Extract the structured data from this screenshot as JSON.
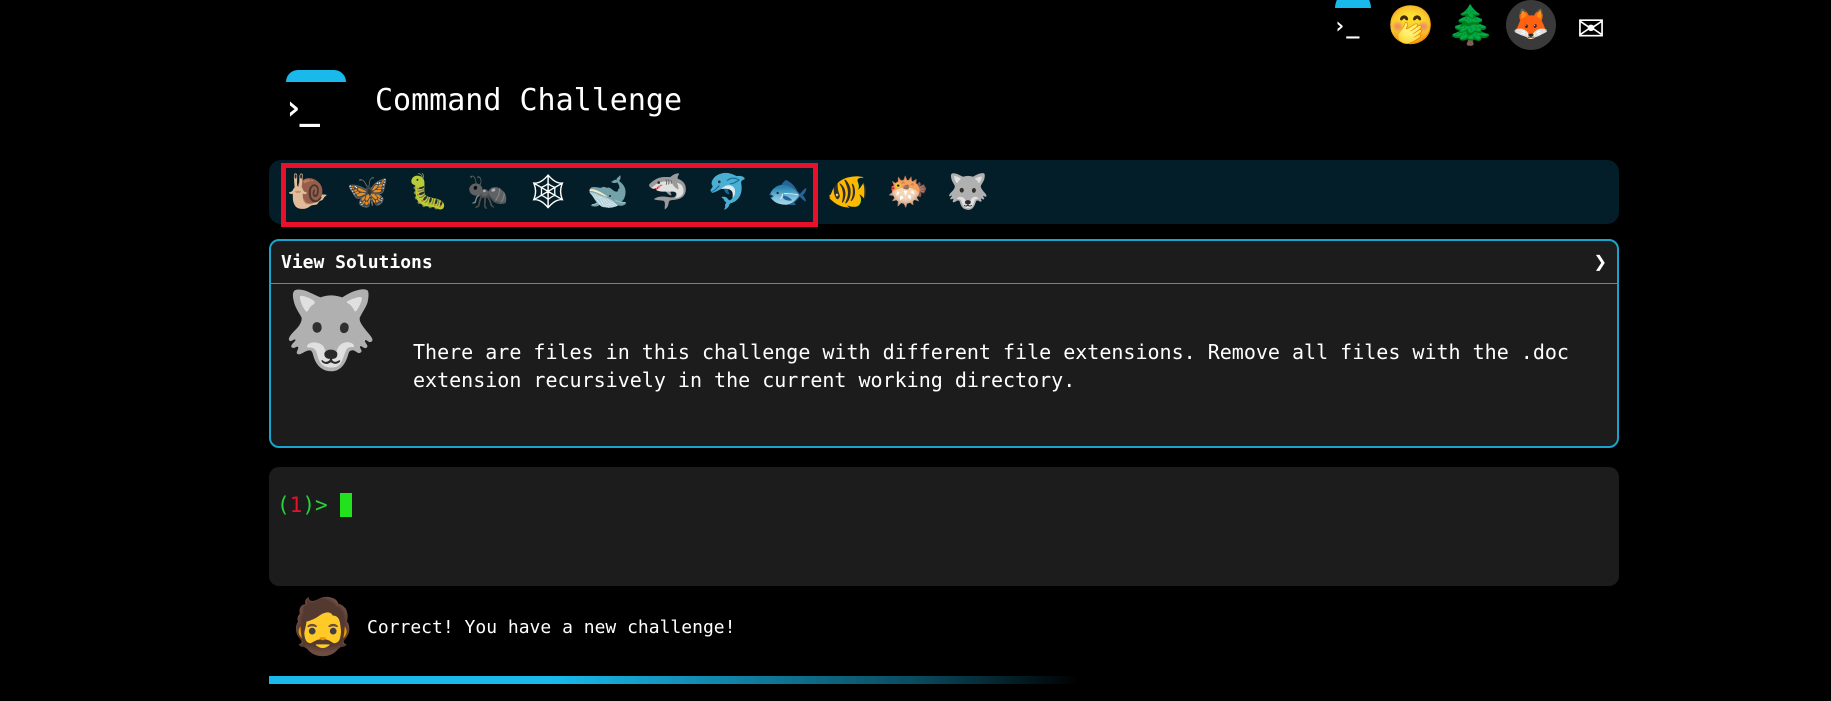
{
  "topnav": {
    "icons": [
      {
        "name": "terminal-logo-icon",
        "glyph": ""
      },
      {
        "name": "face-with-hand-over-mouth-icon",
        "glyph": "🤭"
      },
      {
        "name": "evergreen-tree-icon",
        "glyph": "🌲"
      },
      {
        "name": "gitlab-icon",
        "glyph": "🦊"
      },
      {
        "name": "envelope-icon",
        "glyph": "✉"
      }
    ]
  },
  "header": {
    "title": "Command Challenge",
    "logo_glyph": "›_"
  },
  "levels": [
    {
      "name": "snail",
      "glyph": "🐌",
      "completed": true
    },
    {
      "name": "butterfly",
      "glyph": "🦋",
      "completed": true
    },
    {
      "name": "caterpillar",
      "glyph": "🐛",
      "completed": true
    },
    {
      "name": "ant",
      "glyph": "🐜",
      "completed": true
    },
    {
      "name": "spider-web",
      "glyph": "🕸",
      "completed": true
    },
    {
      "name": "whale",
      "glyph": "🐋",
      "completed": true
    },
    {
      "name": "shark",
      "glyph": "🦈",
      "completed": true
    },
    {
      "name": "dolphin",
      "glyph": "🐬",
      "completed": true
    },
    {
      "name": "fish",
      "glyph": "🐟",
      "completed": true
    },
    {
      "name": "tropical-fish",
      "glyph": "🐠",
      "completed": false
    },
    {
      "name": "blowfish",
      "glyph": "🐡",
      "completed": false
    },
    {
      "name": "wolf",
      "glyph": "🐺",
      "completed": false
    }
  ],
  "solutions": {
    "title": "View Solutions",
    "arrow": "❯",
    "wolf_glyph": "🐺",
    "challenge_text": "There are files in this challenge with different file extensions. Remove all files with the .doc extension recursively in the current working directory."
  },
  "terminal": {
    "open_paren": "(",
    "number": "1",
    "close_prompt": ")>"
  },
  "feedback": {
    "avatar_glyph": "🧔",
    "message": "Correct! You have a new challenge!"
  },
  "colors": {
    "accent": "#19b9ec",
    "highlight": "#e8102a",
    "prompt_green": "#27d33a",
    "cursor_green": "#21e21d"
  }
}
